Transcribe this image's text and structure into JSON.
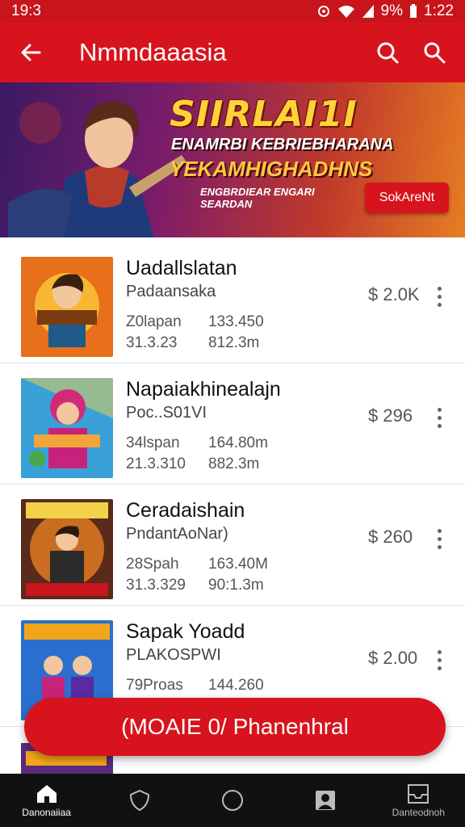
{
  "status": {
    "time_left": "19:3",
    "battery": "9%",
    "time_right": "1:22"
  },
  "appbar": {
    "title": "Nmmdaaasia",
    "back_icon": "arrow-left-icon",
    "search_icon": "search-icon",
    "search2_icon": "search-icon"
  },
  "banner": {
    "line1": "SIIRLAI1I",
    "line2": "ENAMRBI KEBRIEBHARANA",
    "line3": "YEKAMHIGHADHNS",
    "line4": "ENGBRDIEAR ENGARI SEARDAN",
    "cta": "SokAreNt"
  },
  "list": [
    {
      "name": "Uadallslatan",
      "sub": "Padaansaka",
      "m1": "Z0lapan",
      "m2": "31.3.23",
      "m3": "133.450",
      "m4": "812.3m",
      "price": "$ 2.0K"
    },
    {
      "name": "Napaiakhinealajn",
      "sub": "Poc..S01VI",
      "m1": "34lspan",
      "m2": "21.3.310",
      "m3": "164.80m",
      "m4": "882.3m",
      "price": "$ 296"
    },
    {
      "name": "Ceradaishain",
      "sub": "PndantAoNar)",
      "m1": "28Spah",
      "m2": "31.3.329",
      "m3": "163.40M",
      "m4": "90:1.3m",
      "price": "$ 260"
    },
    {
      "name": "Sapak Yoadd",
      "sub": "PLAKOSPWI",
      "m1": "79Proas",
      "m2": "",
      "m3": "144.260",
      "m4": "",
      "price": "$ 2.00"
    }
  ],
  "fab": {
    "label": "(MOAIE 0/ Phanenhral"
  },
  "nav": [
    {
      "label": "Danonaiiaa",
      "icon": "home-icon"
    },
    {
      "label": "",
      "icon": "shield-icon"
    },
    {
      "label": "",
      "icon": "circle-icon"
    },
    {
      "label": "",
      "icon": "profile-icon"
    },
    {
      "label": "Danteodnoh",
      "icon": "inbox-icon"
    }
  ],
  "colors": {
    "brand_red": "#d7141d",
    "navbar": "#111111"
  }
}
